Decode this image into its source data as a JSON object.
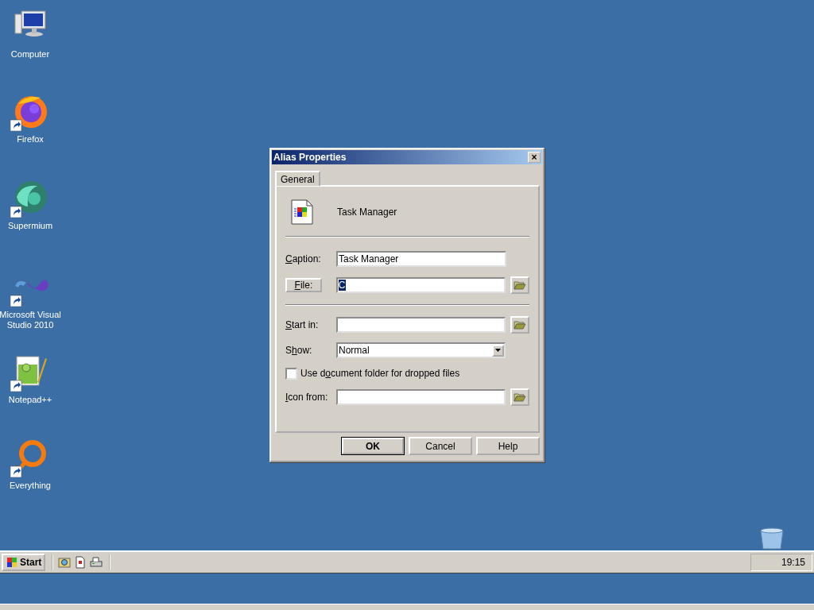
{
  "desktop_icons": [
    {
      "label": "Computer",
      "kind": "computer",
      "shortcut": false
    },
    {
      "label": "Firefox",
      "kind": "firefox",
      "shortcut": true
    },
    {
      "label": "Supermium",
      "kind": "supermium",
      "shortcut": true
    },
    {
      "label": "Microsoft Visual Studio 2010",
      "kind": "vstudio",
      "shortcut": true
    },
    {
      "label": "Notepad++",
      "kind": "notepad",
      "shortcut": true
    },
    {
      "label": "Everything",
      "kind": "everything",
      "shortcut": true
    },
    {
      "kind": "recyclebin"
    }
  ],
  "dialog": {
    "title": "Alias Properties",
    "close_glyph": "×",
    "tabs": [
      {
        "label": "General",
        "selected": true
      }
    ],
    "item_name": "Task Manager",
    "caption": {
      "access_key": "C",
      "label_after": "aption:",
      "value": "Task Manager"
    },
    "file": {
      "access_key": "F",
      "label_after": "ile:",
      "value": "C",
      "text_selected": true
    },
    "start_in": {
      "access_key": "S",
      "label_after": "tart in:"
    },
    "show": {
      "label_before": "S",
      "access_key": "h",
      "label_after": "ow:",
      "value": "Normal"
    },
    "checkbox": {
      "label_before": "Use d",
      "access_key": "o",
      "label_after": "cument folder for dropped files",
      "checked": false
    },
    "icon_from": {
      "access_key": "I",
      "label_after": "con from:"
    },
    "buttons": [
      {
        "label": "OK",
        "default": true
      },
      {
        "label": "Cancel",
        "default": false
      },
      {
        "label": "Help",
        "default": false
      }
    ]
  },
  "taskbar": {
    "start": "Start",
    "quick_launch": [
      {
        "kind": "explorer"
      },
      {
        "kind": "document"
      },
      {
        "kind": "printer"
      }
    ],
    "clock": "19:15"
  }
}
